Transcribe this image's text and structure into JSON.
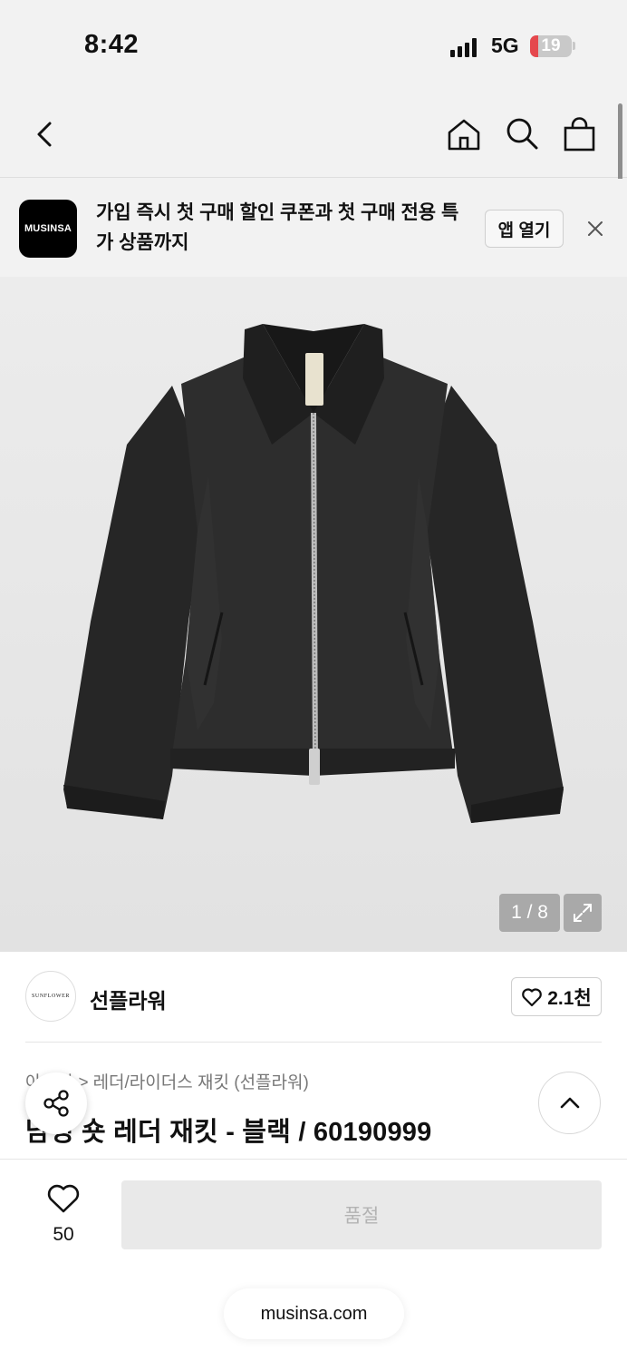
{
  "status_bar": {
    "time": "8:42",
    "network": "5G",
    "battery": "19",
    "battery_fraction": 0.19
  },
  "nav": {
    "icons": [
      "back-icon",
      "home-icon",
      "search-icon",
      "bag-icon"
    ]
  },
  "banner": {
    "logo_text": "MUSINSA",
    "message": "가입 즉시 첫 구매 할인 쿠폰과 첫 구매 전용 특가 상품까지",
    "open_app_label": "앱 열기"
  },
  "gallery": {
    "counter": "1 / 8"
  },
  "brand": {
    "logo_text": "SUNFLOWER",
    "name": "선플라워",
    "likes": "2.1천"
  },
  "product": {
    "breadcrumb_root": "아우터",
    "breadcrumb_separator": ">",
    "breadcrumb_category": "레더/라이더스 재킷 (선플라워)",
    "title": "남성 숏 레더 재킷 - 블랙 / 60190999"
  },
  "actions": {
    "wish_count": "50",
    "soldout_label": "품절"
  },
  "browser": {
    "url": "musinsa.com"
  },
  "colors": {
    "banner_logo_bg": "#000000",
    "soldout_bg": "#e9e9e9",
    "soldout_text": "#b3b3b3",
    "battery_fill": "#e5484d"
  }
}
